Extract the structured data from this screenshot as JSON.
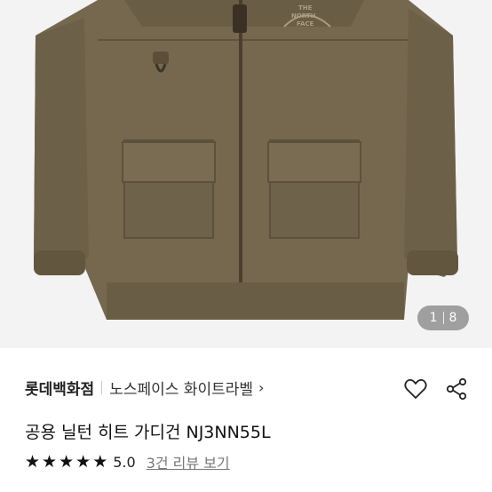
{
  "image": {
    "logo_text": [
      "THE",
      "NORTH",
      "FACE"
    ],
    "counter": {
      "current": "1",
      "total": "8"
    }
  },
  "store": {
    "name": "롯데백화점",
    "brand": "노스페이스 화이트라벨",
    "chevron": "›"
  },
  "product": {
    "title": "공용 닐턴 히트 가디건 NJ3NN55L"
  },
  "rating": {
    "stars": 5,
    "score": "5.0",
    "reviews": "3건 리뷰 보기"
  },
  "icons": {
    "like": "heart-icon",
    "share": "share-icon"
  }
}
